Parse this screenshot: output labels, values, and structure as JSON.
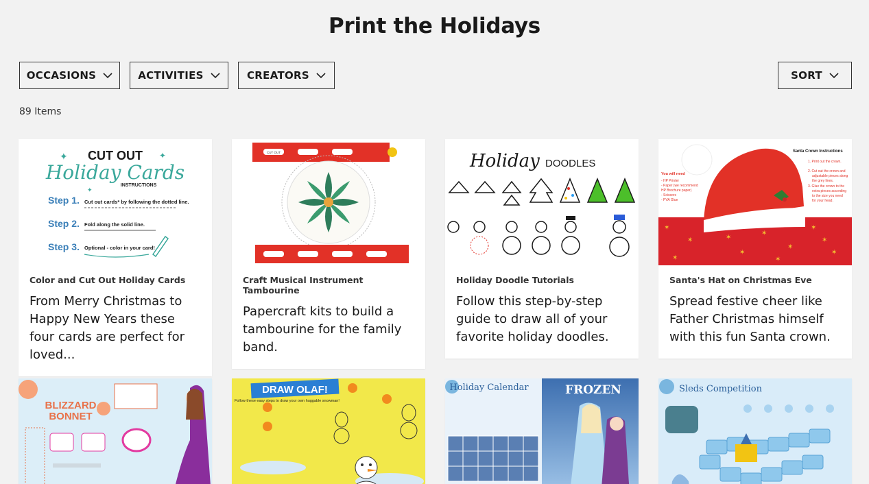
{
  "page_title": "Print the Holidays",
  "filters": {
    "occasions": "OCCASIONS",
    "activities": "ACTIVITIES",
    "creators": "CREATORS",
    "sort": "SORT"
  },
  "items_count": "89 Items",
  "cards": [
    {
      "title": "Color and Cut Out Holiday Cards",
      "desc": "From Merry Christmas to Happy New Years these four cards are perfect for loved...",
      "thumb": {
        "heading1": "CUT OUT",
        "heading2": "Holiday Cards",
        "heading3": "INSTRUCTIONS",
        "step1": "Step 1.",
        "step1_text": "Cut out cards* by following the dotted line.",
        "step2": "Step 2.",
        "step2_text": "Fold along the solid line.",
        "step3": "Step 3.",
        "step3_text": "Optional - color in your card!"
      }
    },
    {
      "title": "Craft Musical Instrument Tambourine",
      "desc": "Papercraft kits to build a tambourine for the family band.",
      "thumb": {
        "tab_label": "CUT OUT"
      }
    },
    {
      "title": "Holiday Doodle Tutorials",
      "desc": "Follow this step-by-step guide to draw all of your favorite holiday doodles.",
      "thumb": {
        "heading1": "Holiday",
        "heading2": "DOODLES"
      }
    },
    {
      "title": "Santa's Hat on Christmas Eve",
      "desc": "Spread festive cheer like Father Christmas himself with this fun Santa crown.",
      "thumb": {
        "heading": "Santa Crown Instructions",
        "need_title": "You will need",
        "need_items": [
          "- HP Printer",
          "- Paper (we recommend",
          "  HP Brochure paper)",
          "- Scissors",
          "- PVA Glue"
        ],
        "steps": [
          "1. Print out the crown.",
          "2. Cut out the crown and",
          "adjustable pieces along",
          "the grey lines.",
          "3. Glue the crown to the",
          "extra pieces according",
          "to the size you need",
          "for your head."
        ]
      }
    },
    {
      "thumb": {
        "heading1": "BLIZZARD",
        "heading2": "BONNET"
      }
    },
    {
      "thumb": {
        "heading": "DRAW OLAF!",
        "subheading": "Follow these easy steps to draw your own huggable snowman!"
      }
    },
    {
      "thumb": {
        "heading": "Holiday Calendar",
        "brand": "FROZEN"
      }
    },
    {
      "thumb": {
        "heading": "Sleds Competition"
      }
    }
  ],
  "colors": {
    "background": "#f2f2f2",
    "card": "#ffffff",
    "text": "#1a1a1a",
    "border": "#333333"
  }
}
